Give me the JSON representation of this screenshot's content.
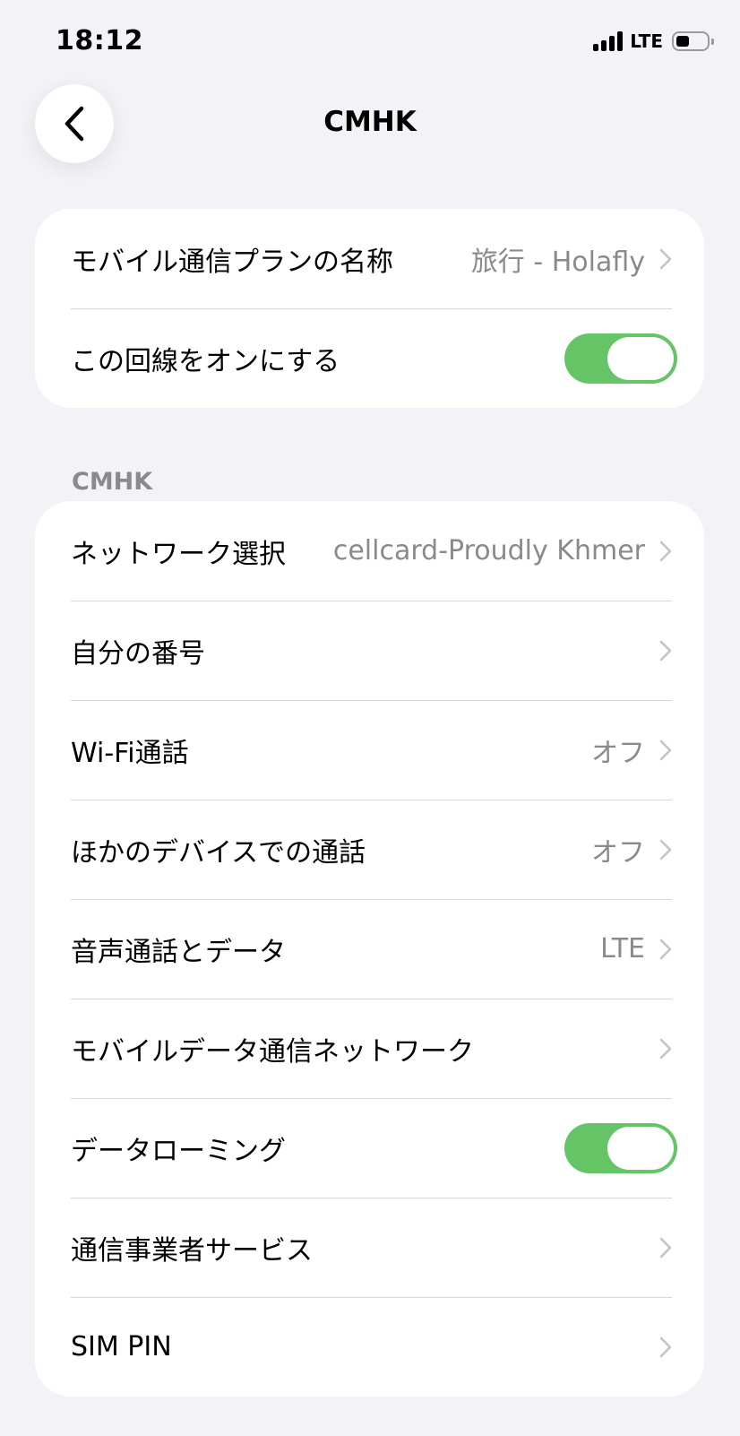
{
  "status_bar": {
    "time": "18:12",
    "network": "LTE"
  },
  "nav": {
    "title": "CMHK",
    "back_icon": "chevron-left-icon"
  },
  "group1": {
    "rows": [
      {
        "label": "モバイル通信プランの名称",
        "value": "旅行 - Holafly"
      },
      {
        "label": "この回線をオンにする",
        "toggle": true
      }
    ]
  },
  "section": {
    "header": "CMHK"
  },
  "group2": {
    "rows": [
      {
        "label": "ネットワーク選択",
        "value": "cellcard-Proudly Khmer"
      },
      {
        "label": "自分の番号"
      },
      {
        "label": "Wi-Fi通話",
        "value": "オフ"
      },
      {
        "label": "ほかのデバイスでの通話",
        "value": "オフ"
      },
      {
        "label": "音声通話とデータ",
        "value": "LTE"
      },
      {
        "label": "モバイルデータ通信ネットワーク"
      },
      {
        "label": "データローミング",
        "toggle": true
      },
      {
        "label": "通信事業者サービス"
      },
      {
        "label": "SIM PIN"
      }
    ]
  },
  "colors": {
    "background": "#f2f2f7",
    "toggle_on": "#65c466",
    "secondary_text": "#8a8a8e"
  }
}
